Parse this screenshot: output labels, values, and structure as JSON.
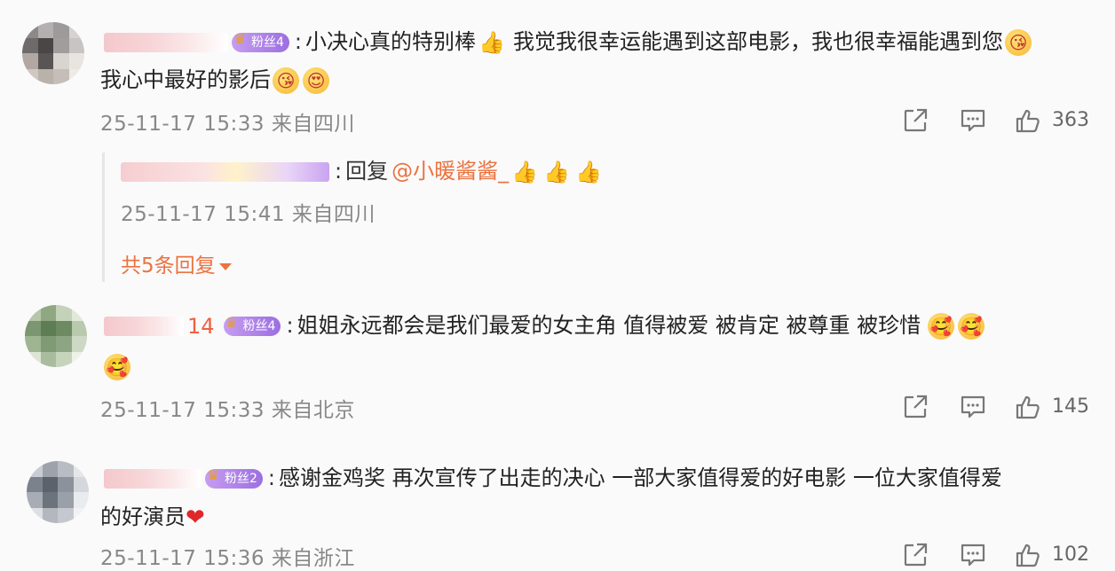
{
  "comments": [
    {
      "badge": "粉丝4",
      "text_line1": "小决心真的特别棒",
      "text_line1b": "我觉我很幸运能遇到这部电影，我也很幸福能遇到您",
      "text_line2": "我心中最好的影后",
      "time": "25-11-17 15:33",
      "location": "来自四川",
      "likes": "363",
      "reply": {
        "prefix": "回复",
        "mention": "@小暖酱酱_",
        "time": "25-11-17 15:41",
        "location": "来自四川",
        "more": "共5条回复"
      }
    },
    {
      "name_suffix": "14",
      "badge": "粉丝4",
      "text_line1": "姐姐永远都会是我们最爱的女主角 值得被爱 被肯定  被尊重  被珍惜",
      "time": "25-11-17 15:33",
      "location": "来自北京",
      "likes": "145"
    },
    {
      "badge": "粉丝2",
      "text_line1": "感谢金鸡奖 再次宣传了出走的决心 一部大家值得爱的好电影 一位大家值得爱",
      "text_line2": "的好演员",
      "time": "25-11-17 15:36",
      "location": "来自浙江",
      "likes": "102"
    }
  ],
  "colors": {
    "accent": "#eb7340",
    "badge": "#9b6fe0",
    "meta": "#888888"
  },
  "icons": [
    "share-icon",
    "comment-icon",
    "like-icon",
    "crown-icon",
    "emoji-face-icon",
    "thumbs-up-icon",
    "heart-icon",
    "caret-down-icon"
  ]
}
